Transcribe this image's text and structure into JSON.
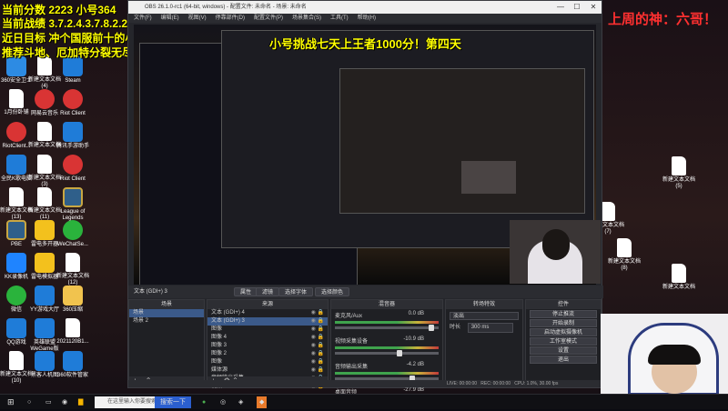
{
  "overlay": {
    "line1": "当前分数 2223  小号364",
    "line2": "当前战绩 3.7.2.4.3.7.8.2.2.4.5.1",
    "line3": "近日目标 冲个国服前十的小号",
    "line4": "推荐斗地、厄加特分裂无尽轻语",
    "challenge": "小号挑战七天上王者1000分！第四天",
    "banner": "上周的神：六哥！"
  },
  "desktop_icons": [
    {
      "label": "360安全卫士",
      "icon": "shield-icon"
    },
    {
      "label": "新建文本文档 (4)",
      "icon": "document-icon"
    },
    {
      "label": "Steam",
      "icon": "steam-icon"
    },
    {
      "label": "1月份卧铺",
      "icon": "document-icon"
    },
    {
      "label": "网易云音乐",
      "icon": "netease-music-icon"
    },
    {
      "label": "Riot Client",
      "icon": "riot-icon"
    },
    {
      "label": "RiotClient...",
      "icon": "riot-icon"
    },
    {
      "label": "新建文本文档",
      "icon": "document-icon"
    },
    {
      "label": "腾讯手游助手",
      "icon": "game-icon"
    },
    {
      "label": "全民K歌电脑",
      "icon": "app-icon"
    },
    {
      "label": "新建文本文档 (3)",
      "icon": "document-icon"
    },
    {
      "label": "Riot Client",
      "icon": "riot-icon"
    },
    {
      "label": "新建文本文档 (13)",
      "icon": "document-icon"
    },
    {
      "label": "新建文本文档 (11)",
      "icon": "document-icon"
    },
    {
      "label": "League of Legends",
      "icon": "lol-icon"
    },
    {
      "label": "PBE",
      "icon": "lol-icon"
    },
    {
      "label": "雷电多开器",
      "icon": "emulator-icon"
    },
    {
      "label": "WeChatSe...",
      "icon": "wechat-icon"
    },
    {
      "label": "KK录像机",
      "icon": "recorder-icon"
    },
    {
      "label": "雷电模拟器",
      "icon": "emulator-icon"
    },
    {
      "label": "新建文本文档 (12)",
      "icon": "document-icon"
    },
    {
      "label": "微信",
      "icon": "wechat-icon"
    },
    {
      "label": "YY游戏大厅",
      "icon": "game-icon"
    },
    {
      "label": "360压缩",
      "icon": "folder-icon"
    },
    {
      "label": "QQ游戏",
      "icon": "game-icon"
    },
    {
      "label": "英雄联盟WeGame版",
      "icon": "game-icon"
    },
    {
      "label": "2021120B1...",
      "icon": "document-icon"
    },
    {
      "label": "新建文本文档 (10)",
      "icon": "document-icon"
    },
    {
      "label": "黑客人机图",
      "icon": "app-icon"
    },
    {
      "label": "360软件管家",
      "icon": "app-icon"
    }
  ],
  "right_icons": [
    {
      "label": "新建文本文档 (5)",
      "icon": "document-icon"
    },
    {
      "label": "新建文本文档 (6)",
      "icon": "document-icon"
    },
    {
      "label": "新建文本文档 (7)",
      "icon": "document-icon"
    },
    {
      "label": "新建文本文档 (8)",
      "icon": "document-icon"
    },
    {
      "label": "新建文本文档",
      "icon": "document-icon"
    }
  ],
  "obs": {
    "title": "OBS 26.1.0-rc1 (64-bit, windows) - 配置文件: 未命名 - 场景: 未命名",
    "menu": [
      "文件(F)",
      "编辑(E)",
      "视图(V)",
      "停靠部件(D)",
      "配置文件(P)",
      "场景集合(S)",
      "工具(T)",
      "帮助(H)"
    ],
    "toolbar": {
      "source_name": "文本 (GDI+) 3",
      "props": "属性",
      "filters": "滤镜",
      "select_font": "选择字体",
      "select_color": "选择颜色"
    },
    "docks": {
      "scenes": {
        "header": "场景",
        "items": [
          "场景",
          "场景 2"
        ],
        "footer": "+  −  ⌃  ⌄"
      },
      "sources": {
        "header": "来源",
        "items": [
          "文本 (GDI+) 4",
          "文本 (GDI+) 3",
          "图像",
          "图像 4",
          "图像 3",
          "图像 2",
          "图像",
          "媒体源",
          "音频输出采集",
          "视频"
        ],
        "footer": "+  −  ⚙  ⌃  ⌄"
      },
      "mixer": {
        "header": "混音器",
        "channels": [
          {
            "name": "麦克风/Aux",
            "db": "0.0 dB"
          },
          {
            "name": "视频采集设备",
            "db": "-10.9 dB"
          },
          {
            "name": "音频输出采集",
            "db": "-4.2 dB"
          },
          {
            "name": "桌面音频",
            "db": "-27.9 dB"
          }
        ]
      },
      "transitions": {
        "header": "转场特效",
        "mode": "淡出",
        "duration_label": "时长",
        "duration_value": "300 ms"
      },
      "controls": {
        "header": "控件",
        "buttons": [
          "停止推流",
          "开始录制",
          "启动虚拟摄像机",
          "工作室模式",
          "设置",
          "退出"
        ]
      }
    },
    "status": {
      "live": "LIVE: 00:00:00",
      "rec": "REC: 00:00:00",
      "cpu": "CPU: 1.0%, 30.00 fps"
    }
  },
  "taskbar": {
    "search_placeholder": "在这里输入你要搜索的内容",
    "active_label": "搜索一下"
  }
}
